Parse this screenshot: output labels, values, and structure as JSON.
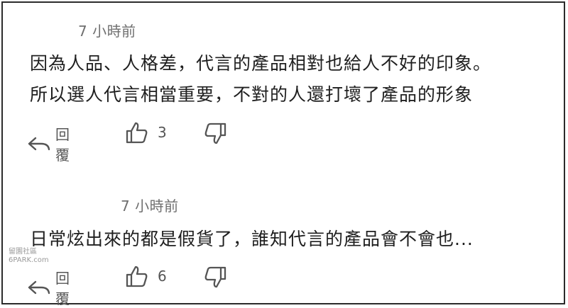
{
  "comments": [
    {
      "time": "7 小時前",
      "lines": [
        "因為人品、人格差，代言的產品相對也給人不好的印象。",
        "所以選人代言相當重要，不對的人還打壞了產品的形象"
      ],
      "reply_label": "回覆",
      "like_count": "3"
    },
    {
      "time": "7 小時前",
      "lines": [
        "日常炫出來的都是假貨了，誰知代言的產品會不會也..."
      ],
      "reply_label": "回覆",
      "like_count": "6"
    }
  ],
  "watermark": {
    "line1": "留園社區",
    "line2": "6PARK.com"
  },
  "icons": {
    "reply": "reply-arrow-icon",
    "like": "thumbs-up-icon",
    "dislike": "thumbs-down-icon"
  }
}
